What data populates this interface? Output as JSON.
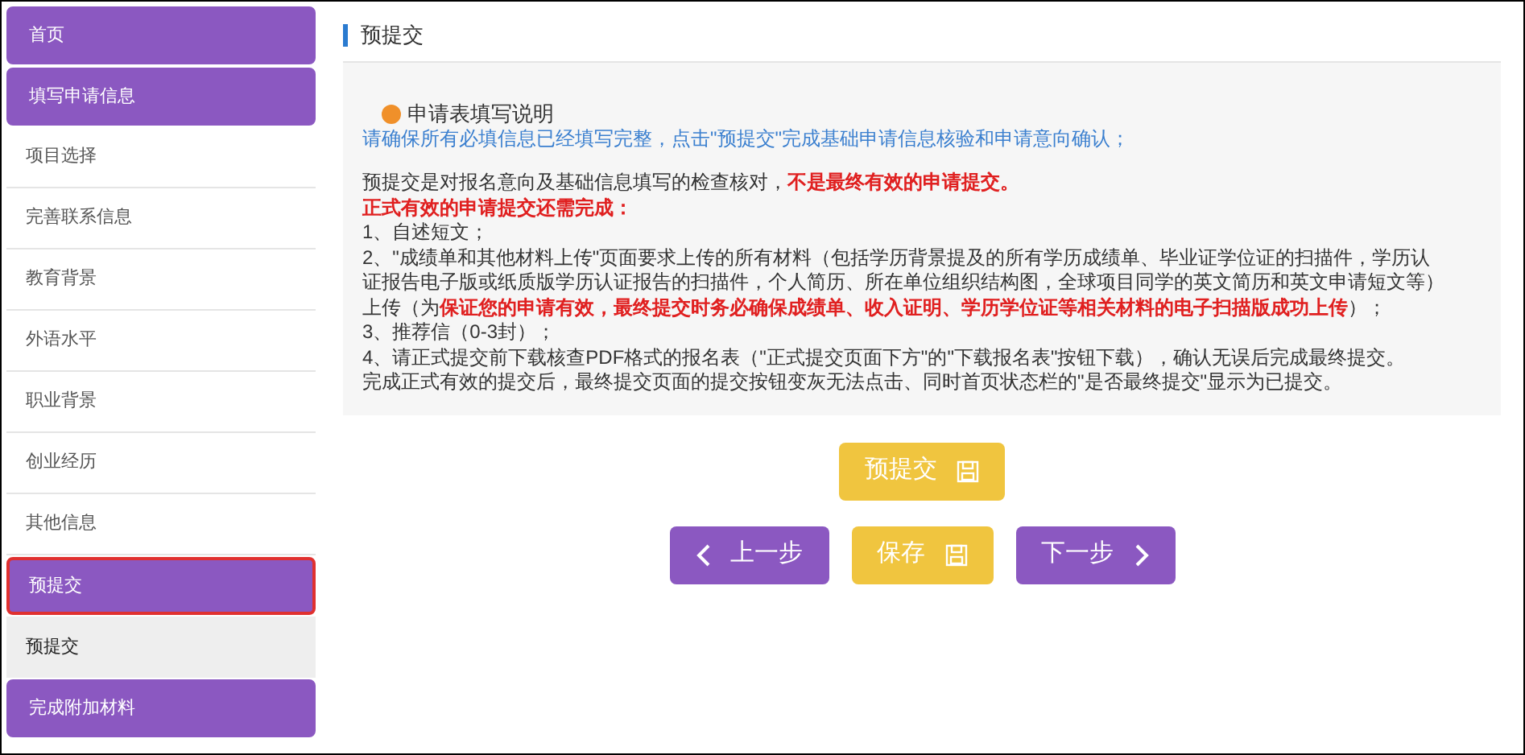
{
  "sidebar": {
    "groups": [
      {
        "label": "首页",
        "highlighted": false
      },
      {
        "label": "填写申请信息",
        "highlighted": false,
        "children": [
          {
            "label": "项目选择",
            "selected": false
          },
          {
            "label": "完善联系信息",
            "selected": false
          },
          {
            "label": "教育背景",
            "selected": false
          },
          {
            "label": "外语水平",
            "selected": false
          },
          {
            "label": "职业背景",
            "selected": false
          },
          {
            "label": "创业经历",
            "selected": false
          },
          {
            "label": "其他信息",
            "selected": false
          }
        ]
      },
      {
        "label": "预提交",
        "highlighted": true,
        "children": [
          {
            "label": "预提交",
            "selected": true
          }
        ]
      },
      {
        "label": "完成附加材料",
        "highlighted": false
      }
    ]
  },
  "page": {
    "title": "预提交",
    "notice": {
      "heading": "申请表填写说明",
      "text": "请确保所有必填信息已经填写完整，点击\"预提交\"完成基础申请信息核验和申请意向确认；"
    },
    "lines": [
      "预提交是对报名意向及基础信息填写的检查核对，**不是最终有效的申请提交。**",
      "**正式有效的申请提交还需完成：**",
      "1、自述短文；",
      "2、\"成绩单和其他材料上传\"页面要求上传的所有材料（包括学历背景提及的所有学历成绩单、毕业证学位证的扫描件，学历认",
      "证报告电子版或纸质版学历认证报告的扫描件，个人简历、所在单位组织结构图，全球项目同学的英文简历和英文申请短文等）",
      "上传（为**保证您的申请有效，最终提交时务必确保成绩单、收入证明、学历学位证等相关材料的电子扫描版成功上传**）；",
      "3、推荐信（0-3封）；",
      "4、请正式提交前下载核查PDF格式的报名表（\"正式提交页面下方\"的\"下载报名表\"按钮下载），确认无误后完成最终提交。",
      "完成正式有效的提交后，最终提交页面的提交按钮变灰无法点击、同时首页状态栏的\"是否最终提交\"显示为已提交。"
    ],
    "submit_buttons": [
      {
        "kind": "save",
        "label": "预提交"
      }
    ],
    "step_buttons": [
      {
        "kind": "prev",
        "label": "上一步"
      },
      {
        "kind": "save",
        "label": "保存"
      },
      {
        "kind": "next",
        "label": "下一步"
      }
    ]
  }
}
